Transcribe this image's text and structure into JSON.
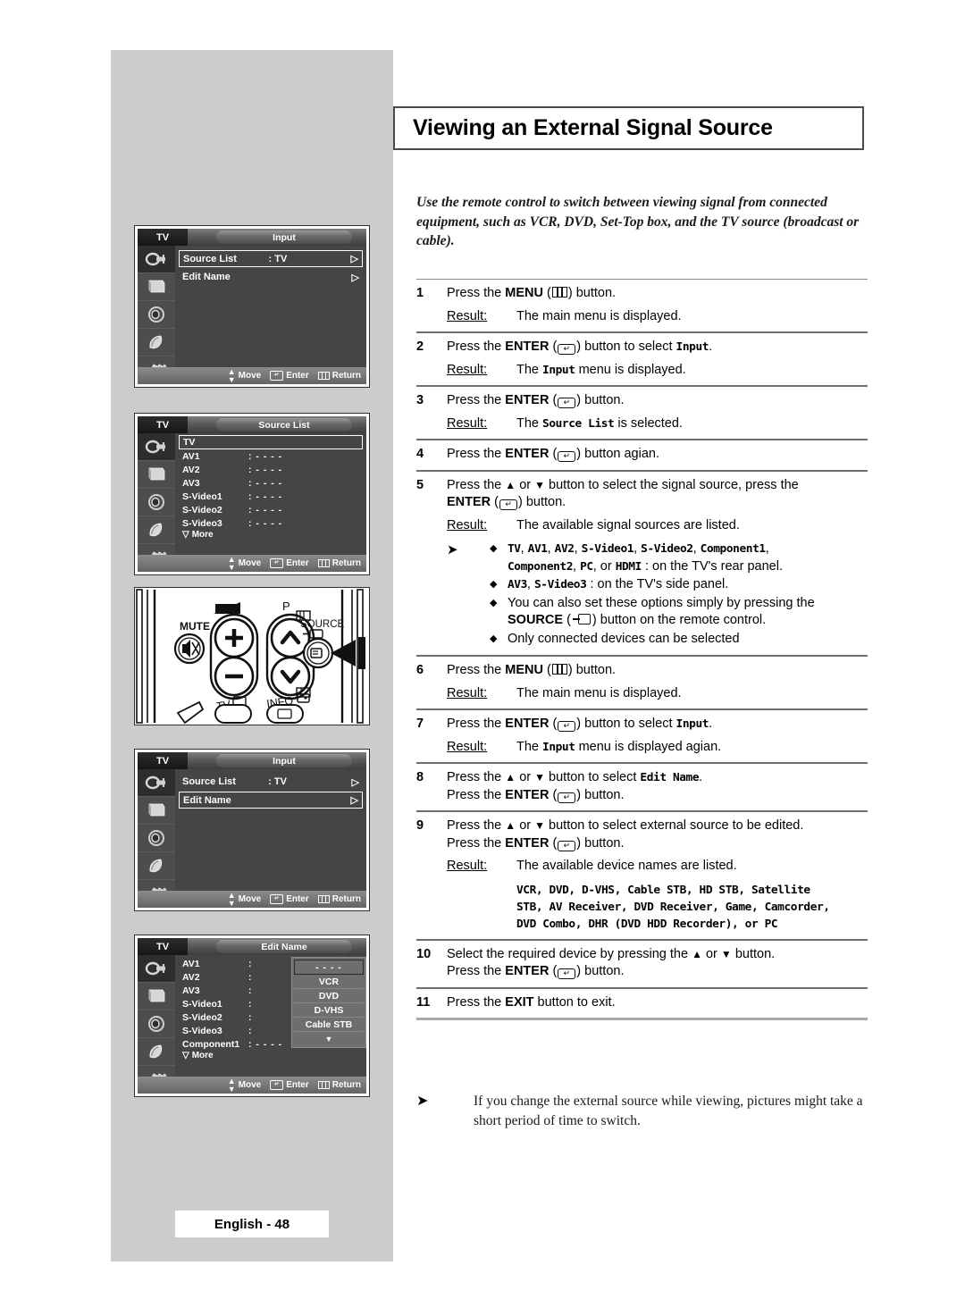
{
  "page": {
    "title": "Viewing an External Signal Source",
    "footer_label": "English - 48",
    "intro": "Use the remote control to switch between viewing signal from connected equipment, such as VCR, DVD, Set-Top box, and the TV source (broadcast or cable)."
  },
  "colors": {
    "panel_gray": "#cccccc",
    "osd_body": "#454545",
    "osd_sidebar": "#4d4d4d",
    "rule": "#6f6f6f"
  },
  "steps": [
    {
      "num": "1",
      "text_a": "Press the ",
      "kw": "MENU",
      "glyph": "menu",
      "text_b": ") button.",
      "result_label": "Result:",
      "result_a": "The main menu is displayed.",
      "result_mono": "",
      "result_b": ""
    },
    {
      "num": "2",
      "text_a": "Press the ",
      "kw": "ENTER",
      "glyph": "enter",
      "text_b": ") button to select ",
      "mono_tail": "Input",
      "tail": ".",
      "result_label": "Result:",
      "result_a": "The ",
      "result_mono": "Input",
      "result_b": " menu is displayed."
    },
    {
      "num": "3",
      "text_a": "Press the ",
      "kw": "ENTER",
      "glyph": "enter",
      "text_b": ") button.",
      "result_label": "Result:",
      "result_a": "The ",
      "result_mono": "Source List",
      "result_b": " is selected."
    },
    {
      "num": "4",
      "text_a": "Press the ",
      "kw": "ENTER",
      "glyph": "enter",
      "text_b": ") button agian."
    },
    {
      "num": "5",
      "line1_a": "Press the ",
      "line1_b": " or ",
      "line1_c": " button to select the signal source, press the",
      "line2_kw": "ENTER",
      "line2_tail": ") button.",
      "result_label": "Result:",
      "result_a": "The available signal sources are listed."
    },
    {
      "num": "6",
      "text_a": "Press the ",
      "kw": "MENU",
      "glyph": "menu",
      "text_b": ") button.",
      "result_label": "Result:",
      "result_a": "The main menu is displayed."
    },
    {
      "num": "7",
      "text_a": "Press the ",
      "kw": "ENTER",
      "glyph": "enter",
      "text_b": ") button to select ",
      "mono_tail": "Input",
      "tail": ".",
      "result_label": "Result:",
      "result_a": "The ",
      "result_mono": "Input",
      "result_b": " menu is displayed agian."
    },
    {
      "num": "8",
      "line1_a": "Press the ",
      "line1_b": " or ",
      "line1_c": " button to select ",
      "line1_mono": "Edit Name",
      "line1_tail": ".",
      "line2_a": "Press the ",
      "line2_kw": "ENTER",
      "line2_tail": ") button."
    },
    {
      "num": "9",
      "line1_a": "Press the ",
      "line1_b": " or ",
      "line1_c": " button to select external source to be edited.",
      "line2_a": "Press the ",
      "line2_kw": "ENTER",
      "line2_tail": ") button.",
      "result_label": "Result:",
      "result_a": "The available device names are listed."
    },
    {
      "num": "10",
      "line1_a": "Select the required device by pressing the ",
      "line1_b": " or ",
      "line1_c": " button.",
      "line2_a": "Press the ",
      "line2_kw": "ENTER",
      "line2_tail": ") button."
    },
    {
      "num": "11",
      "text_a": "Press the ",
      "kw": "EXIT",
      "text_b": " button to exit."
    }
  ],
  "bullets": {
    "b1_mono_1": "TV",
    "b1_mono_2": "AV1",
    "b1_mono_3": "AV2",
    "b1_mono_4": "S-Video1",
    "b1_mono_5": "S-Video2",
    "b1_mono_6": "Component1",
    "b1_mono_7": "Component2",
    "b1_mono_8": "PC",
    "b1_or": ", or ",
    "b1_mono_9": "HDMI",
    "b1_tail": " : on the TV's rear panel.",
    "b2_mono_1": "AV3",
    "b2_mono_2": "S-Video3",
    "b2_tail": " : on the TV's side panel.",
    "b3_line1": "You can also set these options simply by pressing the",
    "b3_kw": "SOURCE",
    "b3_tail": ") button on the remote control.",
    "b4": "Only connected devices can be selected"
  },
  "device_names": {
    "line1": "VCR, DVD, D-VHS, Cable STB, HD STB, Satellite",
    "line2": "STB, AV Receiver, DVD Receiver, Game, Camcorder,",
    "line3": "DVD Combo, DHR (DVD HDD Recorder), or PC"
  },
  "footnote": "If you change the external source while viewing, pictures might take a short period of time to switch.",
  "osd_common": {
    "tv_tag": "TV",
    "bottom_move": "Move",
    "bottom_enter": "Enter",
    "bottom_return": "Return",
    "more_label": "More"
  },
  "osd1": {
    "header": "Input",
    "items": [
      {
        "label": "Source List",
        "value": ": TV",
        "arrow": "▷",
        "selected": true
      },
      {
        "label": "Edit Name",
        "value": "",
        "arrow": "▷",
        "selected": false
      }
    ]
  },
  "osd2": {
    "header": "Source List",
    "rows": [
      {
        "name": "TV",
        "value": "",
        "selected": true
      },
      {
        "name": "AV1",
        "value": ": - - - -",
        "selected": false
      },
      {
        "name": "AV2",
        "value": ": - - - -",
        "selected": false
      },
      {
        "name": "AV3",
        "value": ": - - - -",
        "selected": false
      },
      {
        "name": "S-Video1",
        "value": ": - - - -",
        "selected": false
      },
      {
        "name": "S-Video2",
        "value": ": - - - -",
        "selected": false
      },
      {
        "name": "S-Video3",
        "value": ": - - - -",
        "selected": false
      }
    ]
  },
  "osd3": {
    "header": "Input",
    "items": [
      {
        "label": "Source List",
        "value": ": TV",
        "arrow": "▷",
        "selected": false
      },
      {
        "label": "Edit Name",
        "value": "",
        "arrow": "▷",
        "selected": true
      }
    ]
  },
  "osd4": {
    "header": "Edit Name",
    "rows": [
      {
        "name": "AV1",
        "value": ":"
      },
      {
        "name": "AV2",
        "value": ":"
      },
      {
        "name": "AV3",
        "value": ":"
      },
      {
        "name": "S-Video1",
        "value": ":"
      },
      {
        "name": "S-Video2",
        "value": ":"
      },
      {
        "name": "S-Video3",
        "value": ":"
      },
      {
        "name": "Component1",
        "value": ": - - - -"
      }
    ],
    "dropdown": [
      {
        "label": "- - - -",
        "selected": true
      },
      {
        "label": "VCR",
        "selected": false
      },
      {
        "label": "DVD",
        "selected": false
      },
      {
        "label": "D-VHS",
        "selected": false
      },
      {
        "label": "Cable STB",
        "selected": false
      }
    ]
  },
  "remote": {
    "mute_label": "MUTE",
    "vol_plus": "+",
    "vol_minus": "−",
    "p_label": "P",
    "source_label": "SOURCE",
    "tv_label": "TV",
    "info_label": "INFO"
  }
}
